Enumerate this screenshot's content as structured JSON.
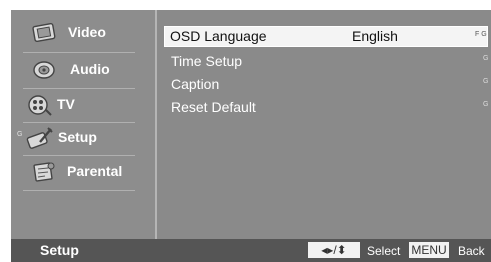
{
  "sidebar": {
    "items": [
      {
        "label": "Video",
        "icon": "video-icon",
        "marker": ""
      },
      {
        "label": "Audio",
        "icon": "audio-icon",
        "marker": ""
      },
      {
        "label": "TV",
        "icon": "tv-icon",
        "marker": ""
      },
      {
        "label": "Setup",
        "icon": "setup-icon",
        "marker": "G"
      },
      {
        "label": "Parental",
        "icon": "parental-icon",
        "marker": ""
      }
    ]
  },
  "menu": {
    "items": [
      {
        "label": "OSD Language",
        "value": "English",
        "mark": "F G"
      },
      {
        "label": "Time Setup",
        "value": "",
        "mark": "G"
      },
      {
        "label": "Caption",
        "value": "",
        "mark": "G"
      },
      {
        "label": "Reset Default",
        "value": "",
        "mark": "G"
      }
    ]
  },
  "footer": {
    "title": "Setup",
    "nav_key": "◂▸/⬍",
    "select_label": "Select",
    "menu_key": "MENU",
    "back_label": "Back"
  },
  "colors": {
    "panel": "#8d8d8d",
    "footer": "#555555",
    "highlight": "#f4f4f4"
  }
}
